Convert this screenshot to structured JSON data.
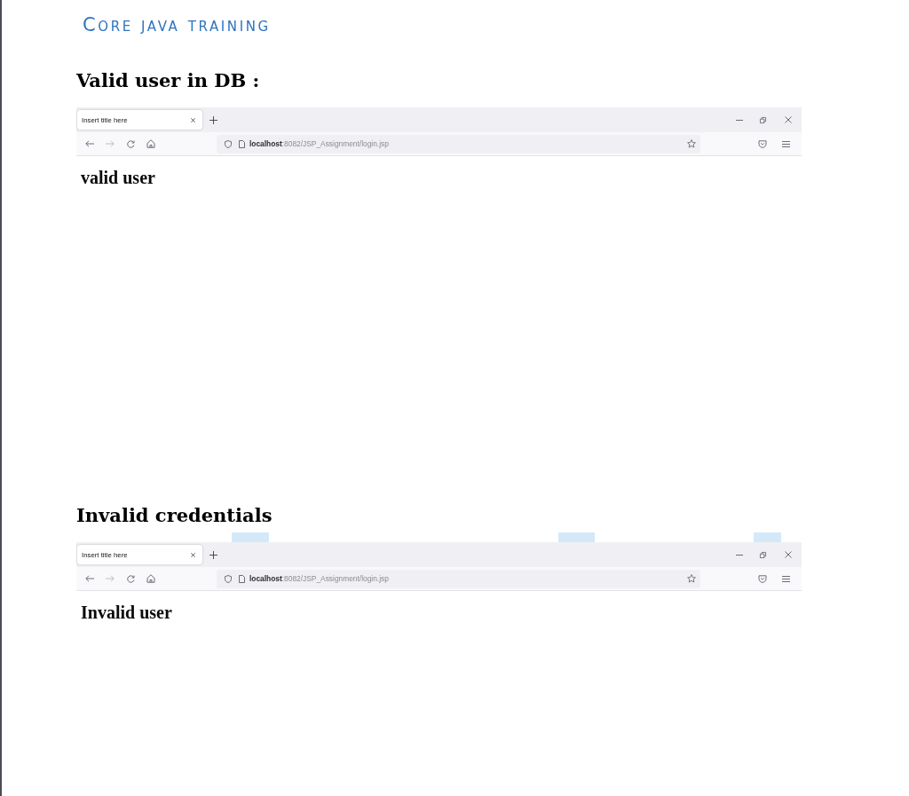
{
  "header": {
    "title": "Core java training"
  },
  "sections": [
    {
      "heading": "Valid user in DB :",
      "highlighted": false,
      "browser": {
        "tabs": [
          {
            "title": "Insert title here",
            "selected": true
          }
        ],
        "back_disabled": false,
        "forward_disabled": true,
        "url": "**localhost**:8082/JSP_Assignment/login.jsp",
        "bookmarked": false,
        "message": "valid user"
      }
    },
    {
      "heading": "Invalid credentials",
      "highlighted": true,
      "browser": {
        "tabs": [
          {
            "title": "Insert title here",
            "selected": true
          }
        ],
        "back_disabled": false,
        "forward_disabled": true,
        "url": "**localhost**:8082/JSP_Assignment/login.jsp",
        "bookmarked": false,
        "message": "Invalid user"
      }
    }
  ]
}
